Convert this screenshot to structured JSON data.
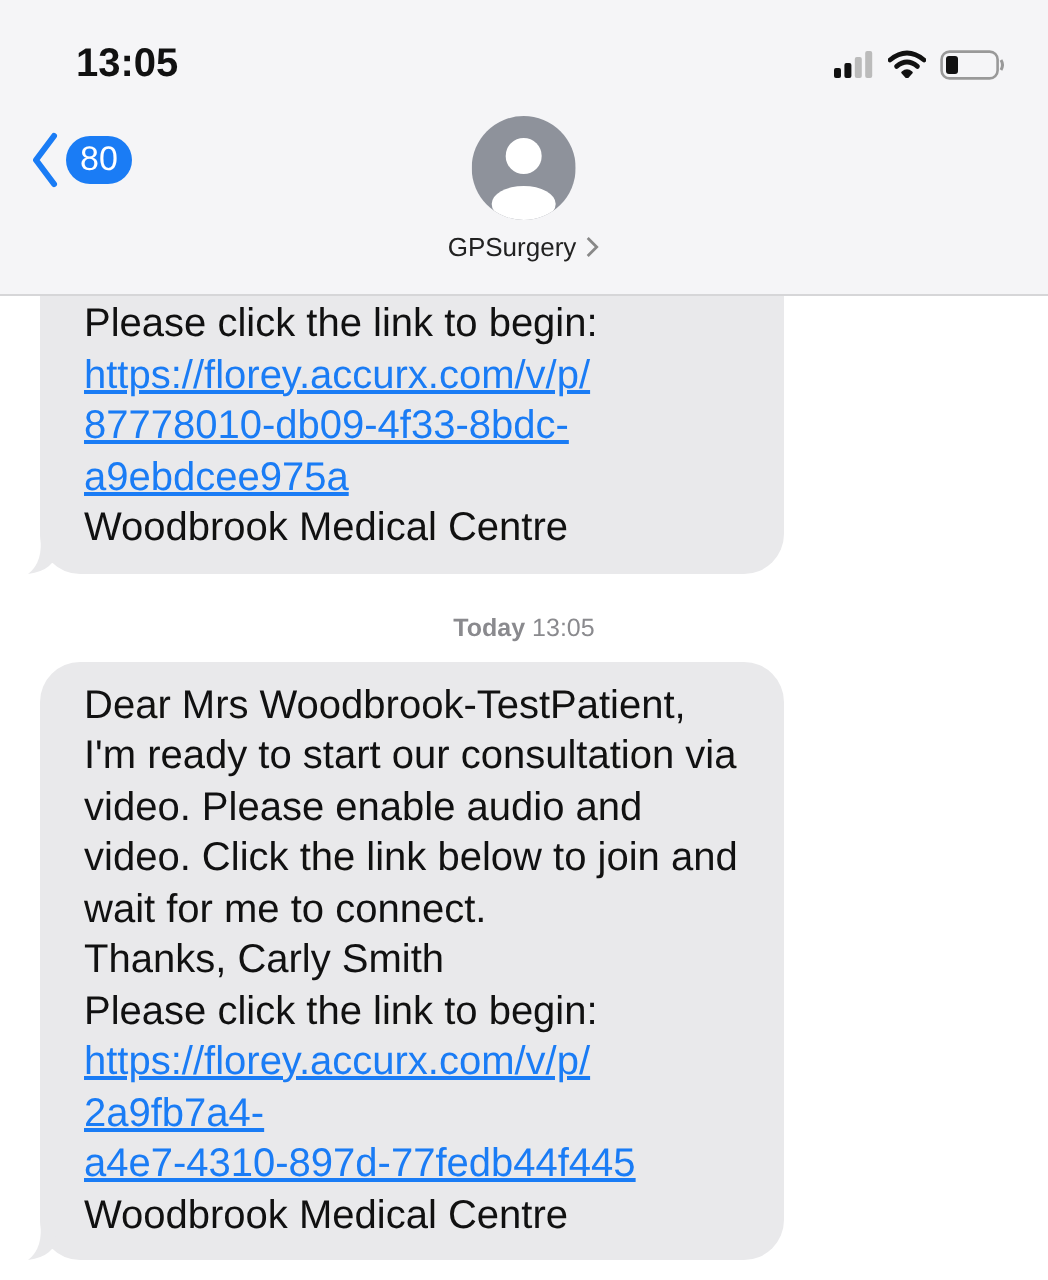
{
  "status_bar": {
    "time": "13:05"
  },
  "nav": {
    "back_count": "80",
    "contact": "GPSurgery"
  },
  "messages": [
    {
      "kind": "received",
      "parts": [
        {
          "kind": "text",
          "text": "Please click the link to begin:"
        },
        {
          "kind": "link",
          "lines": [
            "https://florey.accurx.com/v/p/",
            "87778010-db09-4f33-8bdc-",
            "a9ebdcee975a"
          ]
        },
        {
          "kind": "text",
          "text": "Woodbrook Medical Centre"
        }
      ]
    },
    {
      "kind": "timestamp",
      "day": "Today",
      "time": "13:05"
    },
    {
      "kind": "received",
      "parts": [
        {
          "kind": "text",
          "text": "Dear Mrs Woodbrook-TestPatient, I'm ready to start our consultation via video. Please enable audio and video. Click the link below to join and wait for me to connect."
        },
        {
          "kind": "text",
          "text": "Thanks, Carly Smith"
        },
        {
          "kind": "text",
          "text": "Please click the link to begin:"
        },
        {
          "kind": "link",
          "lines": [
            "https://florey.accurx.com/v/p/",
            "2a9fb7a4-",
            "a4e7-4310-897d-77fedb44f445"
          ]
        },
        {
          "kind": "text",
          "text": "Woodbrook Medical Centre"
        }
      ]
    }
  ]
}
